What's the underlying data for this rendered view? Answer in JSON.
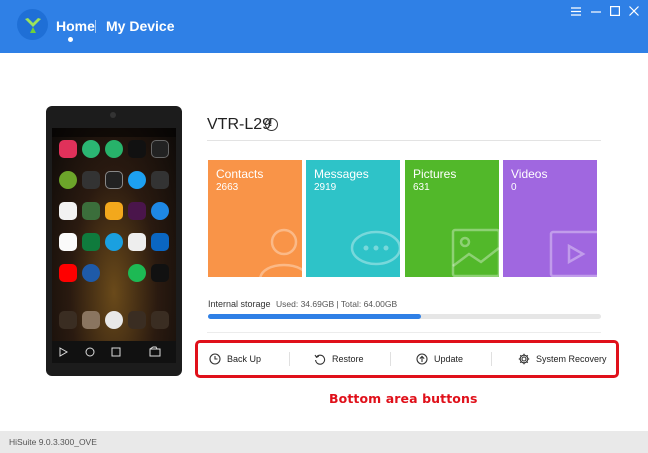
{
  "header": {
    "nav_home": "Home",
    "nav_device": "My Device",
    "accent_color": "#2f80e6"
  },
  "device": {
    "model": "VTR-L29"
  },
  "tiles": [
    {
      "label": "Contacts",
      "count": "2663",
      "color": "#f99448",
      "icon": "contacts-icon"
    },
    {
      "label": "Messages",
      "count": "2919",
      "color": "#2ec3c8",
      "icon": "messages-icon"
    },
    {
      "label": "Pictures",
      "count": "631",
      "color": "#52b82a",
      "icon": "pictures-icon"
    },
    {
      "label": "Videos",
      "count": "0",
      "color": "#a067e0",
      "icon": "videos-icon"
    }
  ],
  "storage": {
    "label": "Internal storage",
    "used_text": "Used: 34.69GB | Total: 64.00GB",
    "used_fraction": 0.542
  },
  "buttons": {
    "backup": "Back Up",
    "restore": "Restore",
    "update": "Update",
    "system_recovery": "System Recovery"
  },
  "annotation": "Bottom area buttons",
  "footer": {
    "version": "HiSuite 9.0.3.300_OVE"
  }
}
